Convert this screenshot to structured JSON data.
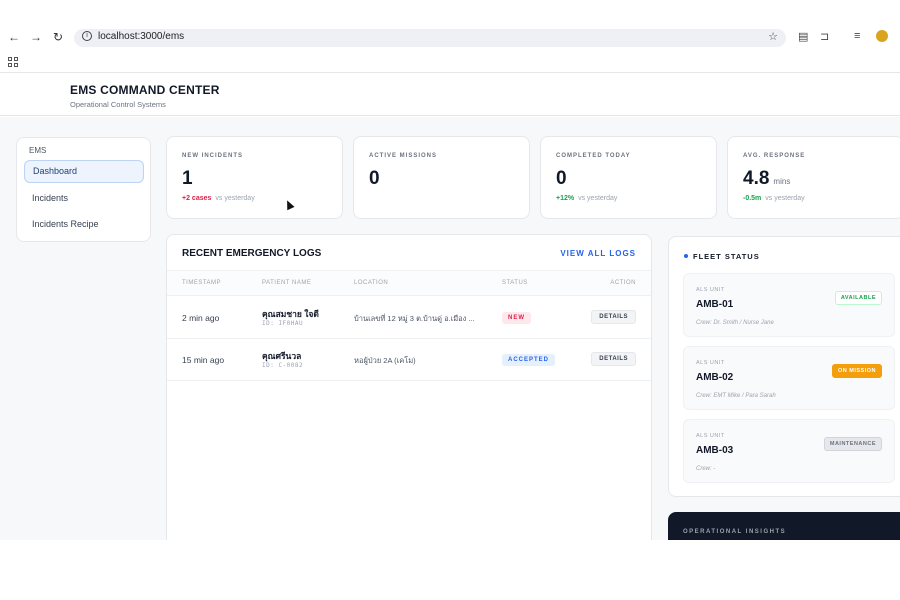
{
  "browser": {
    "url": "localhost:3000/ems",
    "back_icon": "←",
    "forward_icon": "→",
    "reload_icon": "↻"
  },
  "app": {
    "title": "EMS COMMAND CENTER",
    "subtitle": "Operational Control Systems"
  },
  "sidebar": {
    "heading": "EMS",
    "items": [
      {
        "label": "Dashboard",
        "active": true
      },
      {
        "label": "Incidents",
        "active": false
      },
      {
        "label": "Incidents Recipe",
        "active": false
      }
    ]
  },
  "stats": [
    {
      "label": "NEW INCIDENTS",
      "value": "1",
      "unit": "",
      "delta": "+2 cases",
      "compare": "vs yesterday",
      "delta_color": "red"
    },
    {
      "label": "ACTIVE MISSIONS",
      "value": "0",
      "unit": "",
      "delta": "",
      "compare": "",
      "delta_color": ""
    },
    {
      "label": "COMPLETED TODAY",
      "value": "0",
      "unit": "",
      "delta": "+12%",
      "compare": "vs yesterday",
      "delta_color": "green"
    },
    {
      "label": "AVG. RESPONSE",
      "value": "4.8",
      "unit": "mins",
      "delta": "-0.5m",
      "compare": "vs yesterday",
      "delta_color": "green"
    }
  ],
  "logs": {
    "title": "RECENT EMERGENCY LOGS",
    "view_all": "VIEW ALL LOGS",
    "columns": [
      "TIMESTAMP",
      "PATIENT NAME",
      "LOCATION",
      "STATUS",
      "ACTION"
    ],
    "rows": [
      {
        "timestamp": "2 min ago",
        "patient": "คุณสมชาย ใจดี",
        "id": "ID: IF0HAU",
        "location": "บ้านเลขที่ 12 หมู่ 3 ต.บ้านดู่ อ.เมือง ...",
        "status": "NEW",
        "action": "DETAILS"
      },
      {
        "timestamp": "15 min ago",
        "patient": "คุณศรีนวล",
        "id": "ID: C-0082",
        "location": "หอผู้ป่วย 2A (เคโม)",
        "status": "ACCEPTED",
        "action": "DETAILS"
      }
    ]
  },
  "fleet": {
    "title": "FLEET STATUS",
    "units": [
      {
        "type": "ALS UNIT",
        "name": "AMB-01",
        "crew": "Crew: Dr. Smith / Nurse Jane",
        "status": "AVAILABLE"
      },
      {
        "type": "ALS UNIT",
        "name": "AMB-02",
        "crew": "Crew: EMT Mike / Para Sarah",
        "status": "ON MISSION"
      },
      {
        "type": "ALS UNIT",
        "name": "AMB-03",
        "crew": "Crew: -",
        "status": "MAINTENANCE"
      }
    ]
  },
  "insights": {
    "title": "OPERATIONAL INSIGHTS"
  }
}
